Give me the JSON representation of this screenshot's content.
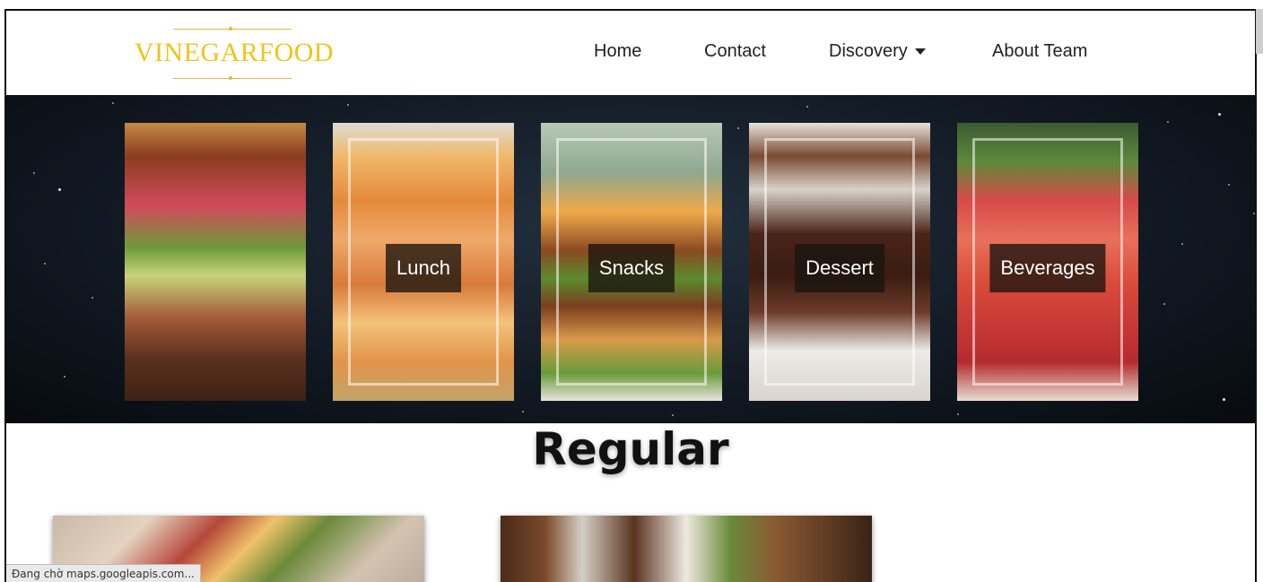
{
  "brand": {
    "name": "VINEGARFOOD",
    "color": "#f0c419"
  },
  "nav": {
    "home": "Home",
    "contact": "Contact",
    "discovery": "Discovery",
    "about": "About Team"
  },
  "categories": [
    {
      "label": "",
      "image": "salad-steak-photo"
    },
    {
      "label": "Lunch",
      "image": "salmon-photo"
    },
    {
      "label": "Snacks",
      "image": "burgers-photo"
    },
    {
      "label": "Dessert",
      "image": "chocolate-dessert-photo"
    },
    {
      "label": "Beverages",
      "image": "strawberry-drink-photo"
    }
  ],
  "section": {
    "title": "Regular"
  },
  "dishes": [
    {
      "image": "plated-dish-photo"
    },
    {
      "image": "coffee-plate-photo"
    }
  ],
  "status_bar": {
    "text": "Đang chờ maps.googleapis.com..."
  }
}
